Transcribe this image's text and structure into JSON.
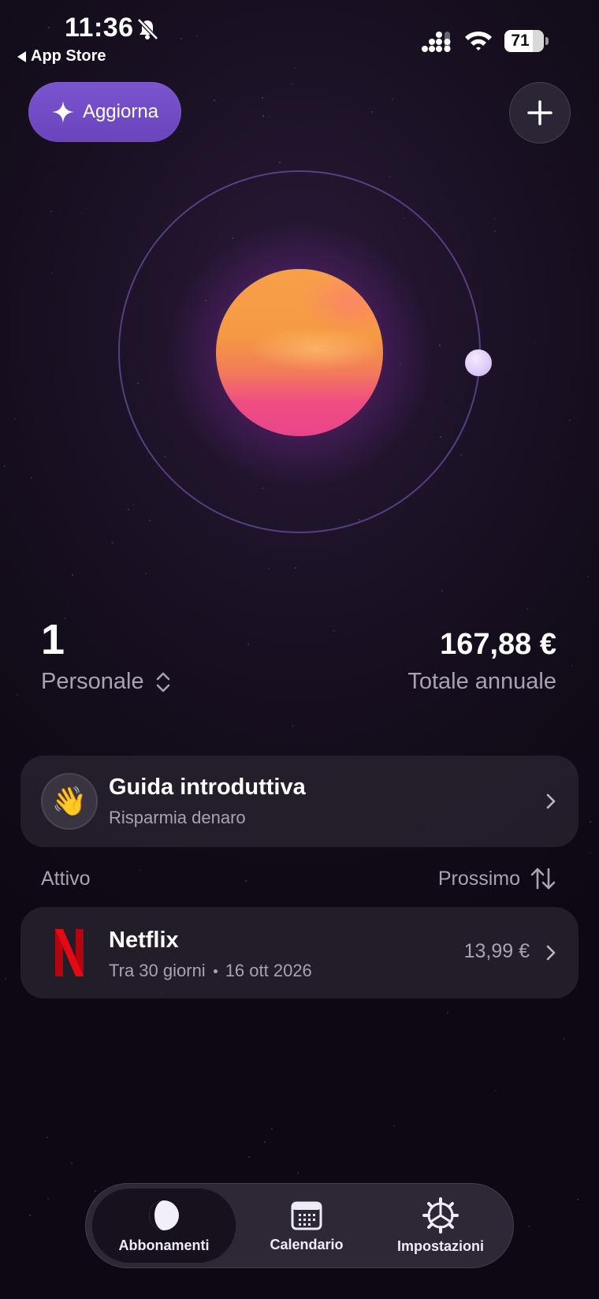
{
  "status_bar": {
    "time": "11:36",
    "back_app": "App Store",
    "battery_level": 71,
    "battery_text": "71"
  },
  "header": {
    "upgrade_label": "Aggiorna"
  },
  "stats": {
    "count": "1",
    "profile": "Personale",
    "total": "167,88 €",
    "total_label": "Totale annuale"
  },
  "guide": {
    "title": "Guida introduttiva",
    "subtitle": "Risparmia denaro",
    "emoji": "👋"
  },
  "section": {
    "left_label": "Attivo",
    "sort_label": "Prossimo"
  },
  "subscriptions": [
    {
      "name": "Netflix",
      "due": "Tra 30 giorni",
      "date": "16 ott 2026",
      "price": "13,99 €",
      "logo_color": "#e50914"
    }
  ],
  "tabs": [
    {
      "label": "Abbonamenti",
      "icon": "planet-icon",
      "active": true
    },
    {
      "label": "Calendario",
      "icon": "calendar-icon",
      "active": false
    },
    {
      "label": "Impostazioni",
      "icon": "gear-icon",
      "active": false
    }
  ],
  "colors": {
    "accent": "#6f49c5",
    "planet_top": "#f7a04a",
    "planet_bottom": "#e8468a",
    "netflix_red": "#e50914"
  }
}
